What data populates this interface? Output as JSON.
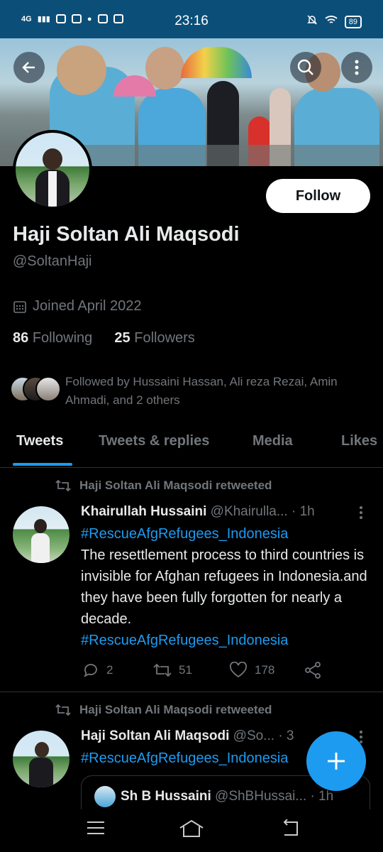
{
  "status_bar": {
    "network": "4G",
    "time": "23:16",
    "battery": "89",
    "icons": [
      "signal-icon",
      "phone-icon",
      "facebook-icon",
      "chat-icon",
      "mail-icon",
      "youtube-icon",
      "mute-icon",
      "wifi-icon",
      "battery-icon"
    ]
  },
  "header": {
    "back_icon": "arrow-left-icon",
    "search_icon": "search-icon",
    "more_icon": "more-vertical-icon"
  },
  "profile": {
    "name": "Haji Soltan Ali Maqsodi",
    "handle": "@SoltanHaji",
    "joined": "Joined April 2022",
    "following_count": "86",
    "following_label": "Following",
    "followers_count": "25",
    "followers_label": "Followers",
    "followed_by": "Followed by Hussaini Hassan, Ali reza Rezai, Amin Ahmadi, and 2 others",
    "follow_button": "Follow"
  },
  "tabs": [
    {
      "label": "Tweets",
      "active": true
    },
    {
      "label": "Tweets & replies",
      "active": false
    },
    {
      "label": "Media",
      "active": false
    },
    {
      "label": "Likes",
      "active": false
    }
  ],
  "tweets": [
    {
      "retweet_label": "Haji Soltan Ali Maqsodi retweeted",
      "author": "Khairullah Hussaini",
      "handle": "@Khairulla...",
      "time": "· 1h",
      "hashtag_top": "#RescueAfgRefugees_Indonesia",
      "text": "The resettlement process to third countries is invisible for Afghan refugees in Indonesia.and they have been fully forgotten for nearly a decade.",
      "hashtag_bottom": "#RescueAfgRefugees_Indonesia",
      "replies": "2",
      "retweets": "51",
      "likes": "178"
    },
    {
      "retweet_label": "Haji Soltan Ali Maqsodi retweeted",
      "author": "Haji Soltan Ali Maqsodi",
      "handle": "@So...",
      "time": "· 3",
      "hashtag_top": "#RescueAfgRefugees_Indonesia",
      "quote": {
        "author": "Sh B Hussaini",
        "handle": "@ShBHussai...",
        "time": "· 1h"
      }
    }
  ],
  "fab": {
    "icon": "plus-icon",
    "label": "+"
  },
  "colors": {
    "accent": "#1d9bf0",
    "background": "#000000",
    "muted": "#71767b",
    "status_bar": "#0b4f79"
  }
}
